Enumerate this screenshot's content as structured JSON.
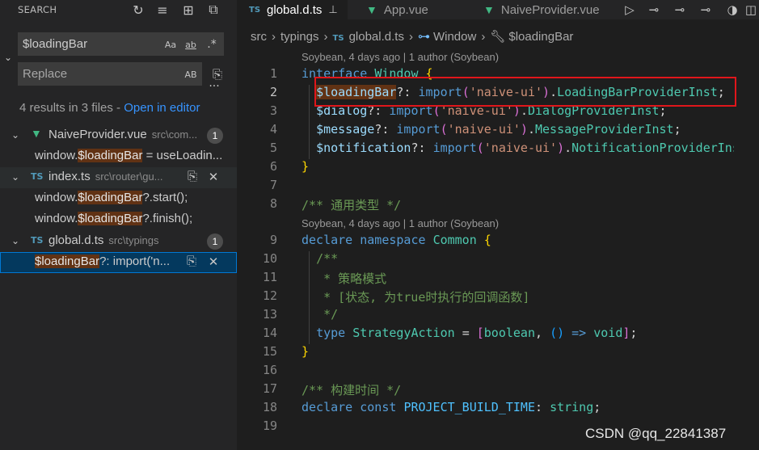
{
  "search_panel": {
    "title": "SEARCH",
    "search": {
      "value": "$loadingBar",
      "match_case": "Aa",
      "whole_word": "ab",
      "regex": ".*"
    },
    "replace": {
      "placeholder": "Replace",
      "preserve_case": "AB"
    },
    "summary": "4 results in 3 files - ",
    "open_in_editor": "Open in editor",
    "results": [
      {
        "file": "NaiveProvider.vue",
        "path": "src\\com...",
        "count": "1",
        "matches": [
          {
            "before": "window.",
            "match": "$loadingBar",
            "after": " = useLoadin..."
          }
        ]
      },
      {
        "file": "index.ts",
        "path": "src\\router\\gu...",
        "count": "",
        "matches": [
          {
            "before": "window.",
            "match": "$loadingBar",
            "after": "?.start();"
          },
          {
            "before": "window.",
            "match": "$loadingBar",
            "after": "?.finish();"
          }
        ]
      },
      {
        "file": "global.d.ts",
        "path": "src\\typings",
        "count": "1",
        "matches": [
          {
            "before": "",
            "match": "$loadingBar",
            "after": "?: import('n..."
          }
        ]
      }
    ]
  },
  "tabs": [
    {
      "label": "global.d.ts",
      "icon": "TS",
      "active": true
    },
    {
      "label": "App.vue",
      "icon": "vue"
    },
    {
      "label": "NaiveProvider.vue",
      "icon": "vue"
    }
  ],
  "breadcrumb": [
    "src",
    "typings",
    "global.d.ts",
    "Window",
    "$loadingBar"
  ],
  "code_lens": {
    "first": "Soybean, 4 days ago | 1 author (Soybean)",
    "second": "Soybean, 4 days ago | 1 author (Soybean)"
  },
  "line_numbers": [
    "1",
    "2",
    "3",
    "4",
    "5",
    "6",
    "7",
    "8",
    "9",
    "10",
    "11",
    "12",
    "13",
    "14",
    "15",
    "16",
    "17",
    "18",
    "19"
  ],
  "watermark": "CSDN @qq_22841387"
}
